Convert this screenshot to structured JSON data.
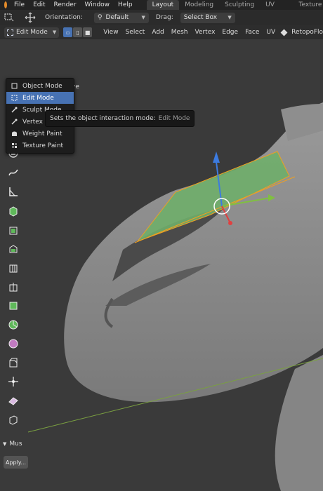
{
  "topbar": {
    "menus": [
      "File",
      "Edit",
      "Render",
      "Window",
      "Help"
    ],
    "workspaces": [
      "Layout",
      "Modeling",
      "Sculpting",
      "UV Editing",
      "Texture Paint"
    ],
    "active_workspace": "Layout"
  },
  "header": {
    "orientation_label": "Orientation:",
    "orientation_value": "Default",
    "drag_label": "Drag:",
    "drag_value": "Select Box"
  },
  "viewport_header": {
    "mode_value": "Edit Mode",
    "menus": [
      "View",
      "Select",
      "Add",
      "Mesh",
      "Vertex",
      "Edge",
      "Face",
      "UV"
    ],
    "retopo_label": "RetopoFlo"
  },
  "mode_menu": {
    "items": [
      {
        "label": "Object Mode",
        "icon": "object-mode-icon",
        "active": false
      },
      {
        "label": "Edit Mode",
        "icon": "edit-mode-icon",
        "active": true
      },
      {
        "label": "Sculpt Mode",
        "icon": "sculpt-mode-icon",
        "active": false
      },
      {
        "label": "Vertex",
        "icon": "vertex-paint-icon",
        "active": false
      },
      {
        "label": "Weight Paint",
        "icon": "weight-paint-icon",
        "active": false
      },
      {
        "label": "Texture Paint",
        "icon": "texture-paint-icon",
        "active": false
      }
    ]
  },
  "tooltip": {
    "text": "Sets the object interaction mode:",
    "value": "Edit Mode"
  },
  "viewport": {
    "partial_label": "tive"
  },
  "tools": [
    "select-box-icon",
    "cursor-icon",
    "move-icon",
    "rotate-icon",
    "scale-icon",
    "transform-icon",
    "annotate-icon",
    "measure-icon",
    "add-cube-icon",
    "extrude-icon",
    "inset-icon",
    "bevel-icon",
    "loop-cut-icon",
    "knife-icon",
    "poly-build-icon",
    "spin-icon",
    "smooth-icon",
    "edge-slide-icon",
    "shrink-fatten-icon",
    "shear-icon",
    "rip-icon"
  ],
  "last_operator": {
    "title": "Mus",
    "apply_label": "Apply..."
  },
  "colors": {
    "accent": "#4772b3",
    "mesh": "#8a8a8a",
    "face_select": "#6fae6a",
    "x_axis": "#80c040",
    "y_axis": "#3c7be0",
    "z_axis": "#e04040"
  }
}
